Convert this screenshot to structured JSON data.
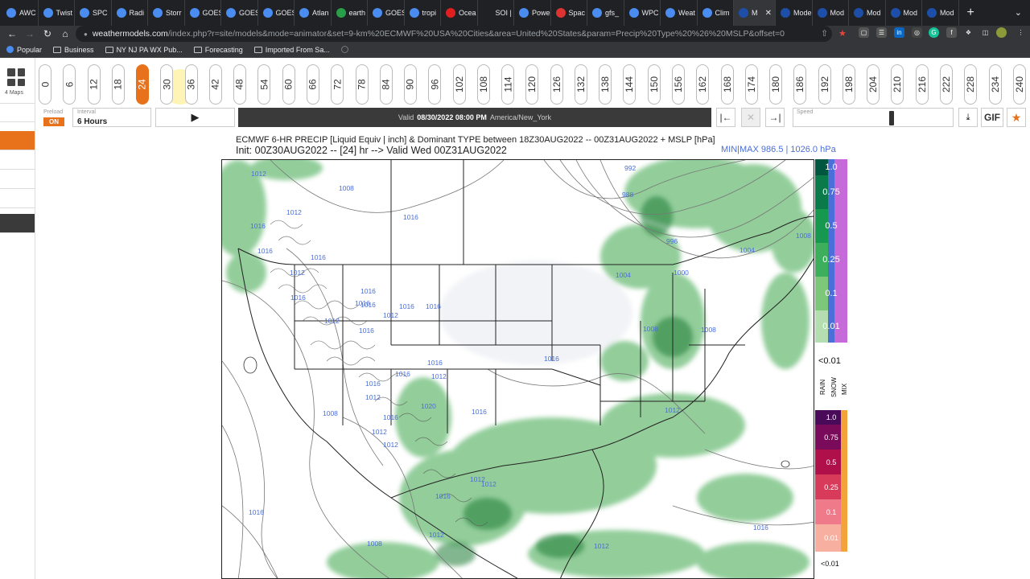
{
  "browser": {
    "tabs": [
      {
        "label": "AWC",
        "icon": "noaa-icon"
      },
      {
        "label": "Twist",
        "icon": "twist-icon"
      },
      {
        "label": "SPC",
        "icon": "noaa-icon"
      },
      {
        "label": "Radi",
        "icon": "radar-icon"
      },
      {
        "label": "Storr",
        "icon": "noaa-icon"
      },
      {
        "label": "GOES",
        "icon": "noaa-icon"
      },
      {
        "label": "GOES",
        "icon": "noaa-icon"
      },
      {
        "label": "GOES",
        "icon": "noaa-icon"
      },
      {
        "label": "Atlan",
        "icon": "noaa-icon"
      },
      {
        "label": "earth",
        "icon": "earth-icon"
      },
      {
        "label": "GOES",
        "icon": "noaa-icon"
      },
      {
        "label": "tropi",
        "icon": "tropical-icon"
      },
      {
        "label": "Ocea",
        "icon": "ocean-icon"
      },
      {
        "label": "SOI |",
        "icon": "soi-icon"
      },
      {
        "label": "Powe",
        "icon": "power-icon"
      },
      {
        "label": "Spac",
        "icon": "space-icon"
      },
      {
        "label": "gfs_",
        "icon": "gfs-icon"
      },
      {
        "label": "WPC",
        "icon": "noaa-icon"
      },
      {
        "label": "Weat",
        "icon": "weather-icon"
      },
      {
        "label": "Clim",
        "icon": "climate-icon"
      },
      {
        "label": "M",
        "icon": "models-icon",
        "active": true
      },
      {
        "label": "Mode",
        "icon": "models-icon"
      },
      {
        "label": "Mod",
        "icon": "models-icon"
      },
      {
        "label": "Mod",
        "icon": "models-icon"
      },
      {
        "label": "Mod",
        "icon": "models-icon"
      },
      {
        "label": "Mod",
        "icon": "models-icon"
      }
    ],
    "url_host": "weathermodels.com",
    "url_rest": "/index.php?r=site/models&mode=animator&set=9-km%20ECMWF%20USA%20Cities&area=United%20States&param=Precip%20Type%20%26%20MSLP&offset=0",
    "bookmarks": [
      "Popular",
      "Business",
      "NY NJ PA WX Pub...",
      "Forecasting",
      "Imported From Sa..."
    ]
  },
  "sidebar": {
    "maps_label": "4 Maps"
  },
  "hours": [
    "0",
    "6",
    "12",
    "18",
    "24",
    "30",
    "36",
    "42",
    "48",
    "54",
    "60",
    "66",
    "72",
    "78",
    "84",
    "90",
    "96",
    "102",
    "108",
    "114",
    "120",
    "126",
    "132",
    "138",
    "144",
    "150",
    "156",
    "162",
    "168",
    "174",
    "180",
    "186",
    "192",
    "198",
    "204",
    "210",
    "216",
    "222",
    "228",
    "234",
    "240"
  ],
  "selected_hour": "24",
  "controls": {
    "preload_label": "Preload",
    "preload_value": "ON",
    "interval_label": "Interval",
    "interval_value": "6 Hours",
    "valid_prefix": "Valid",
    "valid_datetime": "08/30/2022 08:00 PM",
    "valid_tz": "America/New_York",
    "speed_label": "Speed",
    "gif_label": "GIF"
  },
  "chart": {
    "title_line1": "ECMWF 6-HR PRECIP [Liquid Equiv | inch] & Dominant TYPE between 18Z30AUG2022 -- 00Z31AUG2022 + MSLP [hPa]",
    "title_line2": "Init: 00Z30AUG2022 -- [24] hr --> Valid Wed 00Z31AUG2022",
    "minmax": "MIN|MAX 986.5 | 1026.0 hPa",
    "isobars": [
      "1012",
      "1008",
      "1016",
      "1012",
      "1016",
      "1016",
      "1016",
      "1012",
      "1016",
      "1016",
      "1016",
      "1012",
      "1016",
      "1016",
      "1016",
      "1012",
      "1016",
      "1016",
      "1008",
      "1012",
      "1016",
      "1012",
      "1016",
      "1020",
      "1016",
      "1016",
      "1012",
      "1012",
      "1012",
      "1016",
      "1012",
      "1008",
      "1016",
      "1016",
      "1012",
      "1012",
      "992",
      "988",
      "996",
      "1004",
      "1004",
      "1000",
      "1008",
      "1008",
      "1008",
      "1016",
      "1012"
    ],
    "rain_scale": [
      "1.0",
      "0.75",
      "0.5",
      "0.25",
      "0.1",
      "0.01"
    ],
    "mix_scale": [
      "1.0",
      "0.75",
      "0.5",
      "0.25",
      "0.1",
      "0.01"
    ],
    "below_label": "<0.01",
    "type_labels": [
      "RAIN",
      "SNOW",
      "MIX"
    ]
  },
  "colors": {
    "accent": "#e8721c",
    "rain_green": "#2f9e44",
    "isobar_blue": "#4a6fd8"
  }
}
